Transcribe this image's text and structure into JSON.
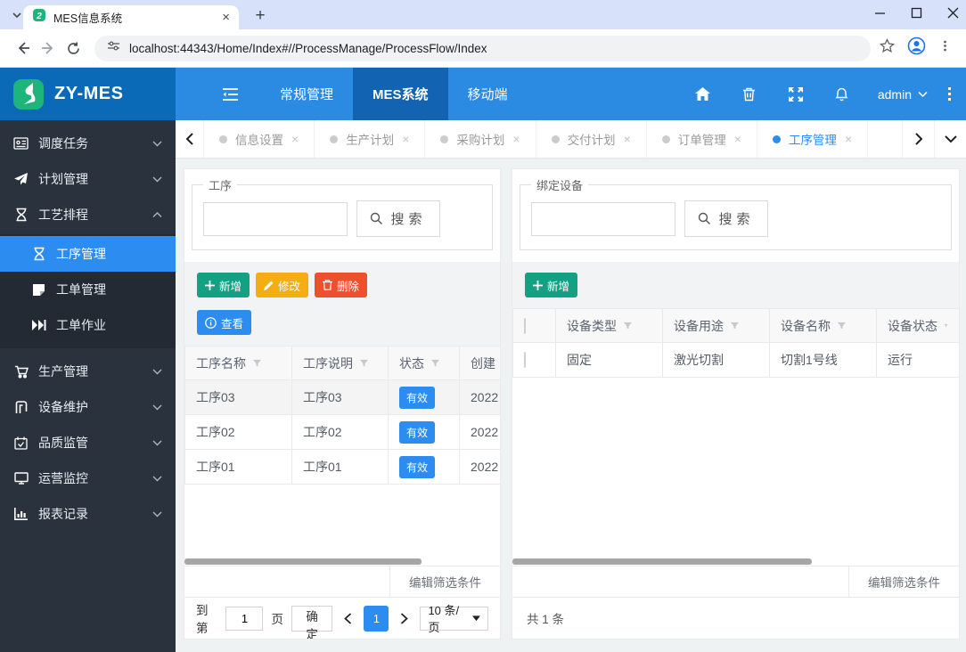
{
  "browser": {
    "tab_title": "MES信息系统",
    "url": "localhost:44343/Home/Index#//ProcessManage/ProcessFlow/Index"
  },
  "header": {
    "logo_text": "ZY-MES",
    "nav": [
      {
        "label": "常规管理"
      },
      {
        "label": "MES系统"
      },
      {
        "label": "移动端"
      }
    ],
    "username": "admin"
  },
  "tab_bar": {
    "tabs": [
      {
        "label": "信息设置"
      },
      {
        "label": "生产计划"
      },
      {
        "label": "采购计划"
      },
      {
        "label": "交付计划"
      },
      {
        "label": "订单管理"
      },
      {
        "label": "工序管理"
      }
    ]
  },
  "sidebar": {
    "items": [
      {
        "label": "调度任务"
      },
      {
        "label": "计划管理"
      },
      {
        "label": "工艺排程"
      },
      {
        "label": "生产管理"
      },
      {
        "label": "设备维护"
      },
      {
        "label": "品质监管"
      },
      {
        "label": "运营监控"
      },
      {
        "label": "报表记录"
      }
    ],
    "process_children": [
      {
        "label": "工序管理"
      },
      {
        "label": "工单管理"
      },
      {
        "label": "工单作业"
      }
    ]
  },
  "left_panel": {
    "legend": "工序",
    "search_value": "",
    "search_label": "搜索",
    "toolbar": {
      "add": "新增",
      "edit": "修改",
      "delete": "删除",
      "view": "查看"
    },
    "table": {
      "headers": [
        "工序名称",
        "工序说明",
        "状态",
        "创建"
      ],
      "rows": [
        {
          "name": "工序03",
          "desc": "工序03",
          "status": "有效",
          "created": "2022"
        },
        {
          "name": "工序02",
          "desc": "工序02",
          "status": "有效",
          "created": "2022"
        },
        {
          "name": "工序01",
          "desc": "工序01",
          "status": "有效",
          "created": "2022"
        }
      ]
    },
    "filter_label": "编辑筛选条件",
    "pagination": {
      "goto": "到第",
      "page_input": "1",
      "page_unit": "页",
      "confirm": "确定",
      "current": "1",
      "page_size": "10 条/页"
    }
  },
  "right_panel": {
    "legend": "绑定设备",
    "search_value": "",
    "search_label": "搜索",
    "toolbar": {
      "add": "新增"
    },
    "table": {
      "headers": [
        "设备类型",
        "设备用途",
        "设备名称",
        "设备状态"
      ],
      "rows": [
        {
          "type": "固定",
          "usage": "激光切割",
          "name": "切割1号线",
          "status": "运行"
        }
      ]
    },
    "filter_label": "编辑筛选条件",
    "total": "共 1 条"
  },
  "colors": {
    "navbar_blue": "#2b8ae2",
    "navbar_active_blue": "#1263b2",
    "logo_bg_blue": "#0a6ab8",
    "sidebar_dark": "#2a323e",
    "sidebar_active_blue": "#2d8cf0",
    "accent_blue": "#2d8cf0",
    "button_green": "#14a183",
    "button_yellow": "#f5ad14",
    "button_red": "#ee4f2d",
    "status_badge_blue": "#2d8cf0"
  }
}
